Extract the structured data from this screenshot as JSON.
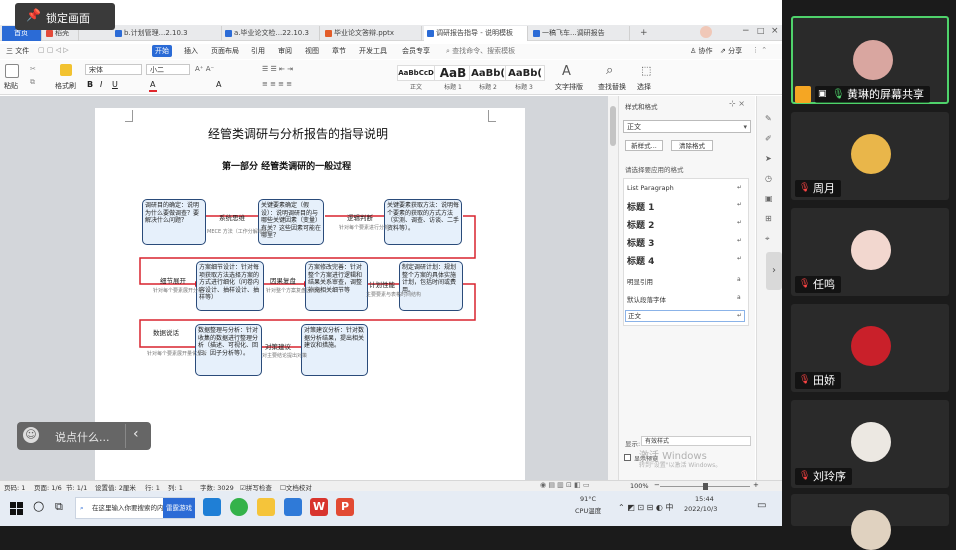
{
  "lock_button": {
    "label": "锁定画面"
  },
  "tabs": [
    {
      "label": "首页",
      "color": "#2b6bd6"
    },
    {
      "label": "稻壳",
      "color": "#e34a3a"
    },
    {
      "label": "b.计划管理...2.10.3",
      "color": "#2b6bd6"
    },
    {
      "label": "a.毕业论文检...22.10.3",
      "color": "#2b6bd6"
    },
    {
      "label": "毕业论文答辩.pptx",
      "color": "#e35d2a"
    },
    {
      "label": "调研报告指导 - 说明模板",
      "color": "#2b6bd6"
    },
    {
      "label": "一稿飞车...调研报告",
      "color": "#2b6bd6"
    }
  ],
  "menu": {
    "file": "三 文件",
    "items": [
      "开始",
      "插入",
      "页面布局",
      "引用",
      "审阅",
      "视图",
      "章节",
      "开发工具",
      "会员专享"
    ],
    "search": "查找命令、搜索模板",
    "right_items": [
      "协作",
      "分享"
    ]
  },
  "ribbon": {
    "paste": "粘贴",
    "format_painter": "格式刷",
    "font_name": "宋体",
    "font_size": "小二",
    "styles": [
      {
        "preview": "AaBbCcD",
        "label": "正文"
      },
      {
        "preview": "AaB",
        "label": "标题 1"
      },
      {
        "preview": "AaBb(",
        "label": "标题 2"
      },
      {
        "preview": "AaBb(",
        "label": "标题 3"
      }
    ],
    "text_layout": "文字排版",
    "find_replace": "查找替换",
    "select": "选择"
  },
  "document": {
    "title": "经管类调研与分析报告的指导说明",
    "subtitle": "第一部分   经管类调研的一般过程"
  },
  "flow": {
    "nodes": [
      {
        "text": "调研目的确定：说明为什么要做调查？要解决什么问题？"
      },
      {
        "text": "关键要素确定（假设）：说明调研目的与哪些关键因素（变量）有关？这些因素可能在哪里？"
      },
      {
        "text": "关键要素获取方法：说明每个要素的获取的方式方法（实测、调查、访谈、二手资料等）。"
      },
      {
        "text": "方案细节设计：针对每项获取方法选择方案的方式进行细化（问卷内容设计、抽样设计、抽样等）"
      },
      {
        "text": "方案修改完善：针对整个方案进行逻辑和结果关系审查，调整补充相关细节等"
      },
      {
        "text": "制定调研计划：规划整个方案的具体实施计划，包括时间或费用。"
      },
      {
        "text": "数据整理与分析：针对收集的数据进行整理分析（描述、可视化、回归、因子分析等）。"
      },
      {
        "text": "对策建议分析：针对数据分析结果，提出相关建议和措施。"
      }
    ],
    "labels": [
      "系统思维",
      "逻辑判断",
      "细节展开",
      "因果复盘",
      "计划性能",
      "数据说话",
      "对策建议"
    ],
    "sublabels": [
      "MECE 方法（工作分解结构）",
      "针对每个要素进行分析",
      "针对每个要素展开分析",
      "针对整个方案复盘因果链",
      "主要要素与表格时间结构",
      "针对每个要素展开量化分析",
      "对主要结论提出对策"
    ]
  },
  "style_panel": {
    "title": "样式和格式",
    "current_style": "正文",
    "new_style": "新样式...",
    "clear_format": "清除格式",
    "section_label": "请选择要应用的格式",
    "styles": [
      {
        "name": "List Paragraph",
        "heading": false
      },
      {
        "name": "标题 1",
        "heading": true
      },
      {
        "name": "标题 2",
        "heading": true
      },
      {
        "name": "标题 3",
        "heading": true
      },
      {
        "name": "标题 4",
        "heading": true
      },
      {
        "name": "明显引用",
        "heading": false
      },
      {
        "name": "默认段落字体",
        "heading": false
      },
      {
        "name": "正文",
        "heading": false
      }
    ],
    "show_label": "显示:",
    "show_value": "有效样式",
    "preview_label": "显示预览",
    "watermark": "激活 Windows",
    "watermark_sub": "转到\"设置\"以激活 Windows。"
  },
  "statusbar": {
    "page": "页码: 1",
    "pages": "页面: 1/6",
    "section": "节: 1/1",
    "setting": "设置值: 2厘米",
    "line": "行: 1",
    "column": "列: 1",
    "words": "字数: 3029",
    "spell": "拼写检查",
    "doc_check": "文档校对",
    "zoom": "100%"
  },
  "taskbar": {
    "search_text": "在这里输入你要搜索的内容",
    "active_app": "雷霆游戏",
    "temp": "91°C",
    "temp_label": "CPU温度",
    "time": "15:44",
    "date": "2022/10/3"
  },
  "chat": {
    "placeholder": "说点什么..."
  },
  "participants": [
    {
      "name": "黄琳的屏幕共享",
      "active": true,
      "avatar_color": "#d9a6a0"
    },
    {
      "name": "周月",
      "active": false,
      "avatar_color": "#e9b64a"
    },
    {
      "name": "任鸣",
      "active": false,
      "avatar_color": "#f2d7cf"
    },
    {
      "name": "田娇",
      "active": false,
      "avatar_color": "#c9202a"
    },
    {
      "name": "刘玲序",
      "active": false,
      "avatar_color": "#ece8e2"
    },
    {
      "name": "",
      "active": false,
      "avatar_color": "#e0d2c0"
    }
  ]
}
